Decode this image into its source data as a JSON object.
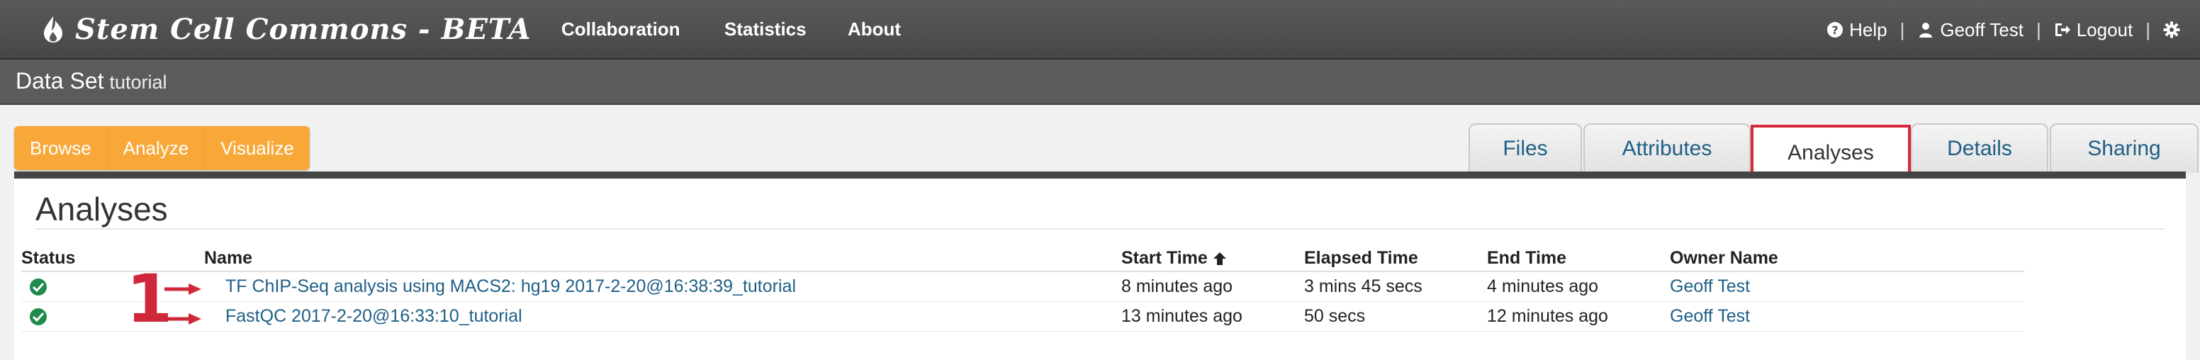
{
  "brand": {
    "name": "Stem Cell Commons - BETA"
  },
  "nav": {
    "links": [
      "Collaboration",
      "Statistics",
      "About"
    ],
    "right": {
      "help": "Help",
      "user": "Geoff Test",
      "logout": "Logout"
    }
  },
  "subheader": {
    "title": "Data Set",
    "subtitle": "tutorial"
  },
  "actions": [
    "Browse",
    "Analyze",
    "Visualize"
  ],
  "tabs": [
    "Files",
    "Attributes",
    "Analyses",
    "Details",
    "Sharing"
  ],
  "active_tab": "Analyses",
  "panel": {
    "heading": "Analyses",
    "columns": [
      "Status",
      "Name",
      "Start Time",
      "Elapsed Time",
      "End Time",
      "Owner Name"
    ],
    "sorted_column": "Start Time",
    "rows": [
      {
        "status": "success",
        "name": "TF ChIP-Seq analysis using MACS2: hg19 2017-2-20@16:38:39_tutorial",
        "start": "8 minutes ago",
        "elapsed": "3 mins 45 secs",
        "end": "4 minutes ago",
        "owner": "Geoff Test"
      },
      {
        "status": "success",
        "name": "FastQC 2017-2-20@16:33:10_tutorial",
        "start": "13 minutes ago",
        "elapsed": "50 secs",
        "end": "12 minutes ago",
        "owner": "Geoff Test"
      }
    ]
  },
  "annotation": {
    "number": "1"
  },
  "colors": {
    "accent_orange": "#f7a839",
    "link_blue": "#1f5f86",
    "highlight_red": "#d6283b",
    "status_green": "#1f8a4c"
  }
}
